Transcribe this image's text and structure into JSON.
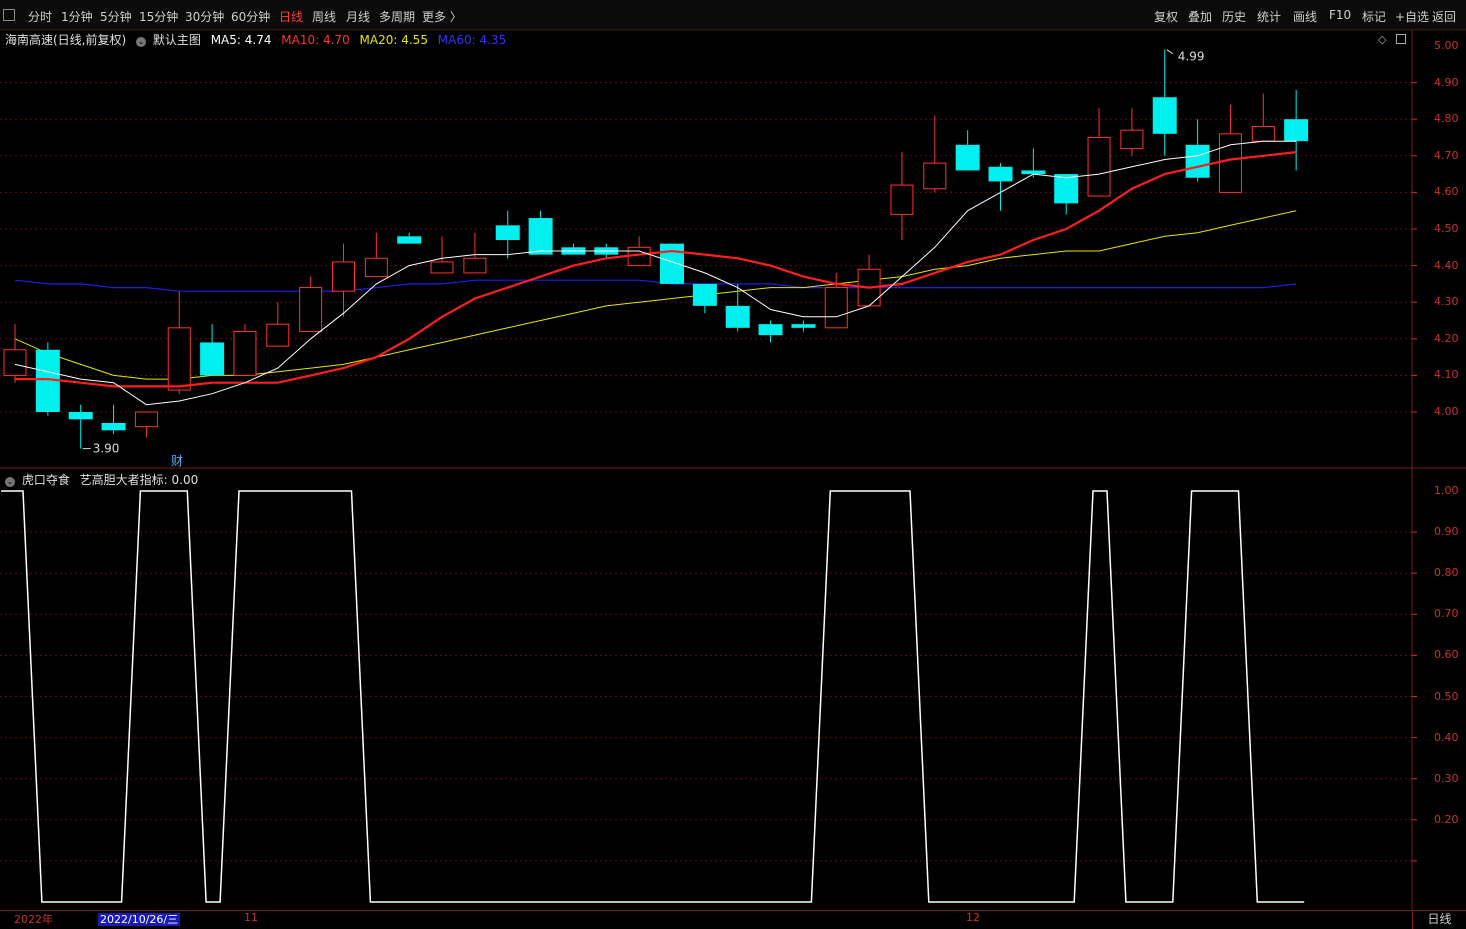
{
  "toolbar": {
    "left": [
      "分时",
      "1分钟",
      "5分钟",
      "15分钟",
      "30分钟",
      "60分钟",
      "日线",
      "周线",
      "月线",
      "多周期",
      "更多 〉"
    ],
    "active_index": 6,
    "right": [
      "复权",
      "叠加",
      "历史",
      "统计",
      "画线",
      "F10",
      "标记",
      "+自选",
      "返回"
    ]
  },
  "main_legend": {
    "stock_name": "海南高速(日线,前复权)",
    "template": "默认主图",
    "ma5": "MA5: 4.74",
    "ma10": "MA10: 4.70",
    "ma20": "MA20: 4.55",
    "ma60": "MA60: 4.35"
  },
  "indicator_legend": {
    "name": "虎口夺食",
    "value_label": "艺高胆大者指标: 0.00"
  },
  "colors": {
    "up": "#ff3232",
    "down": "#00f0f0",
    "ma5": "#ffffff",
    "ma10": "#ff1e1e",
    "ma20": "#e6e600",
    "ma60": "#1e1ee6",
    "axis": "#c83232"
  },
  "price_axis": [
    "5.00",
    "4.90",
    "4.80",
    "4.70",
    "4.60",
    "4.50",
    "4.40",
    "4.30",
    "4.20",
    "4.10",
    "4.00"
  ],
  "indicator_axis": [
    "1.00",
    "0.90",
    "0.80",
    "0.70",
    "0.60",
    "0.50",
    "0.40",
    "0.30",
    "0.20"
  ],
  "annotations": {
    "high_label": "4.99",
    "low_label": "3.90",
    "finance_marker": "财"
  },
  "date_axis": {
    "year": "2022年",
    "cursor_date": "2022/10/26/三",
    "month_11": "11",
    "month_12": "12"
  },
  "period_button": "日线",
  "chart_data": {
    "type": "candlestick",
    "y_range": [
      3.9,
      5.02
    ],
    "candles": [
      {
        "o": 4.1,
        "h": 4.24,
        "l": 4.08,
        "c": 4.17
      },
      {
        "o": 4.17,
        "h": 4.19,
        "l": 3.99,
        "c": 4.0
      },
      {
        "o": 4.0,
        "h": 4.02,
        "l": 3.9,
        "c": 3.98
      },
      {
        "o": 3.97,
        "h": 4.02,
        "l": 3.94,
        "c": 3.95
      },
      {
        "o": 3.96,
        "h": 4.0,
        "l": 3.93,
        "c": 4.0
      },
      {
        "o": 4.06,
        "h": 4.33,
        "l": 4.05,
        "c": 4.23
      },
      {
        "o": 4.19,
        "h": 4.24,
        "l": 4.1,
        "c": 4.1
      },
      {
        "o": 4.1,
        "h": 4.24,
        "l": 4.1,
        "c": 4.22
      },
      {
        "o": 4.18,
        "h": 4.3,
        "l": 4.18,
        "c": 4.24
      },
      {
        "o": 4.22,
        "h": 4.37,
        "l": 4.22,
        "c": 4.34
      },
      {
        "o": 4.33,
        "h": 4.46,
        "l": 4.26,
        "c": 4.41
      },
      {
        "o": 4.37,
        "h": 4.49,
        "l": 4.37,
        "c": 4.42
      },
      {
        "o": 4.48,
        "h": 4.49,
        "l": 4.46,
        "c": 4.46
      },
      {
        "o": 4.38,
        "h": 4.48,
        "l": 4.38,
        "c": 4.41
      },
      {
        "o": 4.38,
        "h": 4.49,
        "l": 4.38,
        "c": 4.42
      },
      {
        "o": 4.51,
        "h": 4.55,
        "l": 4.42,
        "c": 4.47
      },
      {
        "o": 4.53,
        "h": 4.55,
        "l": 4.43,
        "c": 4.43
      },
      {
        "o": 4.45,
        "h": 4.46,
        "l": 4.43,
        "c": 4.43
      },
      {
        "o": 4.45,
        "h": 4.46,
        "l": 4.42,
        "c": 4.43
      },
      {
        "o": 4.4,
        "h": 4.48,
        "l": 4.4,
        "c": 4.45
      },
      {
        "o": 4.46,
        "h": 4.46,
        "l": 4.35,
        "c": 4.35
      },
      {
        "o": 4.35,
        "h": 4.35,
        "l": 4.27,
        "c": 4.29
      },
      {
        "o": 4.29,
        "h": 4.35,
        "l": 4.22,
        "c": 4.23
      },
      {
        "o": 4.24,
        "h": 4.25,
        "l": 4.19,
        "c": 4.21
      },
      {
        "o": 4.24,
        "h": 4.25,
        "l": 4.22,
        "c": 4.23
      },
      {
        "o": 4.23,
        "h": 4.38,
        "l": 4.23,
        "c": 4.34
      },
      {
        "o": 4.29,
        "h": 4.43,
        "l": 4.29,
        "c": 4.39
      },
      {
        "o": 4.54,
        "h": 4.71,
        "l": 4.47,
        "c": 4.62
      },
      {
        "o": 4.61,
        "h": 4.81,
        "l": 4.6,
        "c": 4.68
      },
      {
        "o": 4.73,
        "h": 4.77,
        "l": 4.66,
        "c": 4.66
      },
      {
        "o": 4.67,
        "h": 4.68,
        "l": 4.55,
        "c": 4.63
      },
      {
        "o": 4.66,
        "h": 4.72,
        "l": 4.64,
        "c": 4.65
      },
      {
        "o": 4.65,
        "h": 4.65,
        "l": 4.54,
        "c": 4.57
      },
      {
        "o": 4.59,
        "h": 4.83,
        "l": 4.59,
        "c": 4.75
      },
      {
        "o": 4.72,
        "h": 4.83,
        "l": 4.7,
        "c": 4.77
      },
      {
        "o": 4.86,
        "h": 4.99,
        "l": 4.7,
        "c": 4.76
      },
      {
        "o": 4.73,
        "h": 4.8,
        "l": 4.63,
        "c": 4.64
      },
      {
        "o": 4.6,
        "h": 4.84,
        "l": 4.6,
        "c": 4.76
      },
      {
        "o": 4.74,
        "h": 4.87,
        "l": 4.74,
        "c": 4.78
      },
      {
        "o": 4.8,
        "h": 4.88,
        "l": 4.66,
        "c": 4.74
      }
    ],
    "ma5": [
      4.13,
      4.11,
      4.09,
      4.08,
      4.02,
      4.03,
      4.05,
      4.08,
      4.12,
      4.2,
      4.27,
      4.35,
      4.4,
      4.42,
      4.43,
      4.43,
      4.44,
      4.44,
      4.44,
      4.44,
      4.41,
      4.38,
      4.34,
      4.28,
      4.26,
      4.26,
      4.29,
      4.37,
      4.45,
      4.55,
      4.6,
      4.65,
      4.64,
      4.65,
      4.67,
      4.69,
      4.7,
      4.73,
      4.74,
      4.74
    ],
    "ma10": [
      4.09,
      4.09,
      4.08,
      4.07,
      4.07,
      4.07,
      4.08,
      4.08,
      4.08,
      4.1,
      4.12,
      4.15,
      4.2,
      4.26,
      4.31,
      4.34,
      4.37,
      4.4,
      4.42,
      4.43,
      4.44,
      4.43,
      4.42,
      4.4,
      4.37,
      4.35,
      4.34,
      4.35,
      4.38,
      4.41,
      4.43,
      4.47,
      4.5,
      4.55,
      4.61,
      4.65,
      4.67,
      4.69,
      4.7,
      4.71
    ],
    "ma20": [
      4.2,
      4.16,
      4.13,
      4.1,
      4.09,
      4.09,
      4.1,
      4.1,
      4.11,
      4.12,
      4.13,
      4.15,
      4.17,
      4.19,
      4.21,
      4.23,
      4.25,
      4.27,
      4.29,
      4.3,
      4.31,
      4.32,
      4.33,
      4.34,
      4.34,
      4.35,
      4.36,
      4.37,
      4.39,
      4.4,
      4.42,
      4.43,
      4.44,
      4.44,
      4.46,
      4.48,
      4.49,
      4.51,
      4.53,
      4.55
    ],
    "ma60": [
      4.36,
      4.35,
      4.35,
      4.34,
      4.34,
      4.33,
      4.33,
      4.33,
      4.33,
      4.33,
      4.33,
      4.34,
      4.35,
      4.35,
      4.36,
      4.36,
      4.36,
      4.36,
      4.36,
      4.36,
      4.35,
      4.35,
      4.35,
      4.35,
      4.34,
      4.34,
      4.34,
      4.34,
      4.34,
      4.34,
      4.34,
      4.34,
      4.34,
      4.34,
      4.34,
      4.34,
      4.34,
      4.34,
      4.34,
      4.35
    ],
    "indicator": [
      1,
      0,
      0,
      0,
      1,
      1,
      0,
      1,
      1,
      1,
      1,
      0,
      0,
      0,
      0,
      0,
      0,
      0,
      0,
      0,
      0,
      0,
      0,
      0,
      0,
      1,
      1,
      1,
      0,
      0,
      0,
      0,
      0,
      1,
      0,
      0,
      1,
      1,
      0,
      0
    ]
  }
}
